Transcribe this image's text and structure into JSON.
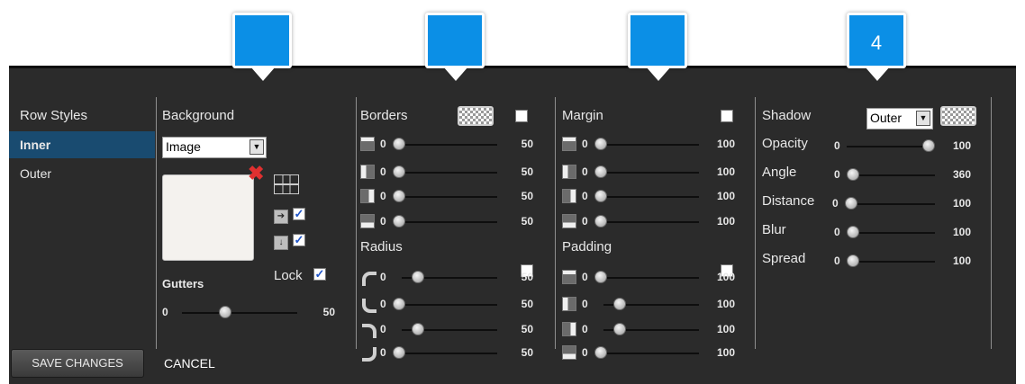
{
  "callouts": [
    {
      "label": ""
    },
    {
      "label": ""
    },
    {
      "label": ""
    },
    {
      "label": "4"
    }
  ],
  "nav": {
    "title": "Row Styles",
    "items": [
      {
        "label": "Inner"
      },
      {
        "label": "Outer"
      }
    ]
  },
  "background": {
    "title": "Background",
    "type": "Image",
    "gutters_label": "Gutters",
    "gutters": {
      "value": "0",
      "max": "50",
      "fraction": 0.36
    },
    "lock_label": "Lock",
    "lock_checked": true,
    "repeat_x_checked": true,
    "repeat_y_checked": true
  },
  "borders": {
    "title": "Borders",
    "enabled": false,
    "rows": [
      {
        "value": "0",
        "max": "50"
      },
      {
        "value": "0",
        "max": "50"
      },
      {
        "value": "0",
        "max": "50"
      },
      {
        "value": "0",
        "max": "50"
      }
    ]
  },
  "radius": {
    "title": "Radius",
    "enabled": false,
    "rows": [
      {
        "value": "0",
        "max": "50"
      },
      {
        "value": "0",
        "max": "50"
      },
      {
        "value": "0",
        "max": "50"
      },
      {
        "value": "0",
        "max": "50"
      }
    ]
  },
  "margin": {
    "title": "Margin",
    "enabled": false,
    "rows": [
      {
        "value": "0",
        "max": "100"
      },
      {
        "value": "0",
        "max": "100"
      },
      {
        "value": "0",
        "max": "100"
      },
      {
        "value": "0",
        "max": "100"
      }
    ]
  },
  "padding": {
    "title": "Padding",
    "enabled": false,
    "rows": [
      {
        "value": "0",
        "max": "100"
      },
      {
        "value": "0",
        "max": "100"
      },
      {
        "value": "0",
        "max": "100"
      },
      {
        "value": "0",
        "max": "100"
      }
    ]
  },
  "shadow": {
    "title": "Shadow",
    "type": "Outer",
    "rows": [
      {
        "label": "Opacity",
        "value": "0",
        "max": "100",
        "fraction": 1.0
      },
      {
        "label": "Angle",
        "value": "0",
        "max": "360",
        "fraction": 0
      },
      {
        "label": "Distance",
        "value": "0",
        "max": "100",
        "fraction": 0
      },
      {
        "label": "Blur",
        "value": "0",
        "max": "100",
        "fraction": 0
      },
      {
        "label": "Spread",
        "value": "0",
        "max": "100",
        "fraction": 0
      }
    ]
  },
  "footer": {
    "save_label": "SAVE CHANGES",
    "cancel_label": "CANCEL"
  },
  "colors": {
    "panel": "#2b2b2b",
    "active_nav": "#194b70",
    "callout": "#0b8fe6"
  }
}
